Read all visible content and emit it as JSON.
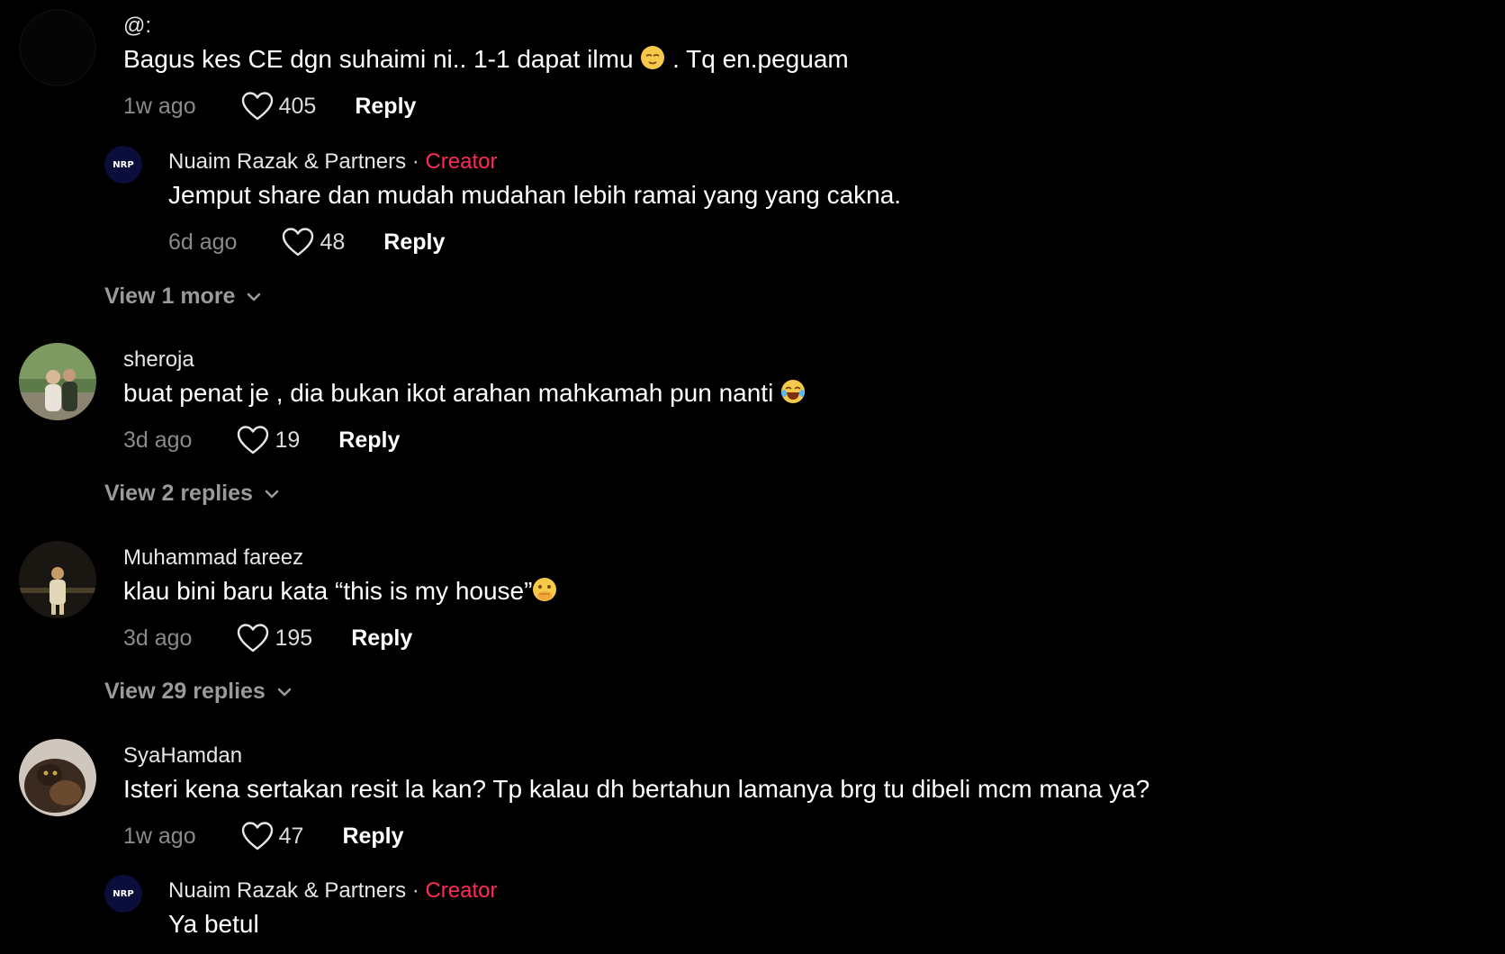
{
  "comments": [
    {
      "username": "@:",
      "text": "Bagus kes CE dgn suhaimi ni.. 1-1 dapat ilmu",
      "text_suffix": ". Tq en.peguam",
      "emoji": "relieved-face",
      "time": "1w ago",
      "likes": "405",
      "reply_label": "Reply"
    },
    {
      "username": "sheroja",
      "text": "buat penat je , dia bukan ikot arahan mahkamah pun nanti",
      "emoji": "tears-of-joy-face",
      "time": "3d ago",
      "likes": "19",
      "reply_label": "Reply",
      "view_more_label": "View 2 replies"
    },
    {
      "username": "Muhammad fareez",
      "text": "klau bini baru kata “this is my house”",
      "emoji": "hand-over-mouth-face",
      "time": "3d ago",
      "likes": "195",
      "reply_label": "Reply",
      "view_more_label": "View 29 replies"
    },
    {
      "username": "SyaHamdan",
      "text": "Isteri kena sertakan resit la kan? Tp kalau dh bertahun lamanya brg tu dibeli mcm mana ya?",
      "time": "1w ago",
      "likes": "47",
      "reply_label": "Reply"
    }
  ],
  "replies": [
    {
      "username": "Nuaim Razak & Partners",
      "separator": "·",
      "badge": "Creator",
      "text": "Jemput share dan mudah mudahan lebih ramai yang yang cakna.",
      "time": "6d ago",
      "likes": "48",
      "reply_label": "Reply",
      "view_more_label": "View 1 more"
    },
    {
      "username": "Nuaim Razak & Partners",
      "separator": "·",
      "badge": "Creator",
      "text": "Ya betul"
    }
  ],
  "colors": {
    "background": "#000000",
    "creator_badge": "#fe2c55",
    "secondary_text": "#8a8a8a"
  },
  "icons": {
    "like": "heart-outline-icon",
    "expand": "chevron-down-icon"
  }
}
